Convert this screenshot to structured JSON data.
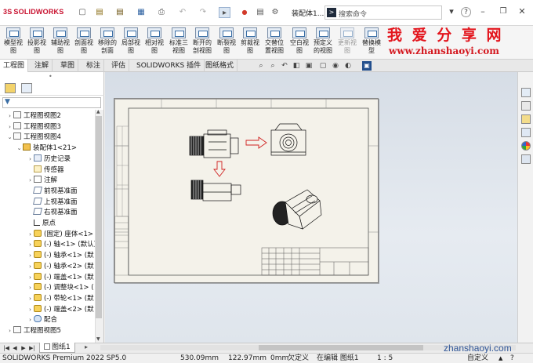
{
  "app": {
    "brand_prefix": "3S",
    "brand": "SOLIDWORKS",
    "document_title": "装配体1...",
    "search_placeholder": "搜索命令",
    "help": "?"
  },
  "quick_access": {
    "new": "▢",
    "open": "▤",
    "save": "▦",
    "print": "⎙",
    "undo": "↶",
    "redo": "↷",
    "select": "▸",
    "rebuild": "●",
    "file_props": "▤",
    "options": "⚙"
  },
  "ribbon": {
    "buttons": [
      {
        "label": "模型视\n图",
        "enabled": true
      },
      {
        "label": "投影视\n图",
        "enabled": true
      },
      {
        "label": "辅助视\n图",
        "enabled": true
      },
      {
        "label": "剖面视\n图",
        "enabled": true
      },
      {
        "label": "移除的\n剖面",
        "enabled": true
      },
      {
        "label": "局部视\n图",
        "enabled": true
      },
      {
        "label": "相对视\n图",
        "enabled": true
      },
      {
        "label": "标准三\n视图",
        "enabled": true
      },
      {
        "label": "断开的\n剖视图",
        "enabled": true
      },
      {
        "label": "断裂视\n图",
        "enabled": true
      },
      {
        "label": "剪裁视\n图",
        "enabled": true
      },
      {
        "label": "交替位\n置视图",
        "enabled": true
      },
      {
        "label": "空白视\n图",
        "enabled": true
      },
      {
        "label": "预定义\n的视图",
        "enabled": true
      },
      {
        "label": "更新视\n图",
        "enabled": false
      },
      {
        "label": "替换模\n型",
        "enabled": true
      }
    ]
  },
  "watermark": {
    "line1": "我 爱 分 享 网",
    "line2": "www.zhanshaoyi.com",
    "bottom": "zhanshaoyi.com"
  },
  "command_tabs": [
    "工程图",
    "注解",
    "草图",
    "标注",
    "评估",
    "SOLIDWORKS 插件",
    "图纸格式"
  ],
  "feature_tree": [
    {
      "label": "工程图视图2",
      "level": 1,
      "icon": "view",
      "expander": "›"
    },
    {
      "label": "工程图视图3",
      "level": 1,
      "icon": "view",
      "expander": "›"
    },
    {
      "label": "工程图视图4",
      "level": 1,
      "icon": "view",
      "expander": "⌄"
    },
    {
      "label": "装配体1<21>",
      "level": 2,
      "icon": "asm",
      "expander": "⌄"
    },
    {
      "label": "历史记录",
      "level": 3,
      "icon": "hist",
      "expander": "›"
    },
    {
      "label": "传感器",
      "level": 3,
      "icon": "sens",
      "expander": ""
    },
    {
      "label": "注解",
      "level": 3,
      "icon": "ann",
      "expander": "›"
    },
    {
      "label": "前视基准面",
      "level": 3,
      "icon": "plane",
      "expander": ""
    },
    {
      "label": "上视基准面",
      "level": 3,
      "icon": "plane",
      "expander": ""
    },
    {
      "label": "右视基准面",
      "level": 3,
      "icon": "plane",
      "expander": ""
    },
    {
      "label": "原点",
      "level": 3,
      "icon": "pt",
      "expander": ""
    },
    {
      "label": "(固定) 座体<1>",
      "level": 3,
      "icon": "yel",
      "expander": "›"
    },
    {
      "label": "(-) 轴<1> (默认)",
      "level": 3,
      "icon": "yel",
      "expander": "›"
    },
    {
      "label": "(-) 轴承<1> (默",
      "level": 3,
      "icon": "yel",
      "expander": "›"
    },
    {
      "label": "(-) 轴承<2> (默",
      "level": 3,
      "icon": "yel",
      "expander": "›"
    },
    {
      "label": "(-) 端盖<1> (默",
      "level": 3,
      "icon": "yel",
      "expander": "›"
    },
    {
      "label": "(-) 调整块<1> (",
      "level": 3,
      "icon": "yel",
      "expander": "›"
    },
    {
      "label": "(-) 带轮<1> (默",
      "level": 3,
      "icon": "yel",
      "expander": "›"
    },
    {
      "label": "(-) 端盖<2> (默",
      "level": 3,
      "icon": "yel",
      "expander": "›"
    },
    {
      "label": "配合",
      "level": 3,
      "icon": "mate",
      "expander": "›"
    },
    {
      "label": "工程图视图5",
      "level": 1,
      "icon": "view",
      "expander": "›"
    }
  ],
  "sheet_tabs": {
    "active": "图纸1",
    "add": "▸"
  },
  "status_bar": {
    "product": "SOLIDWORKS Premium 2022 SP5.0",
    "x": "530.09mm",
    "y": "122.97mm",
    "z": "0mm",
    "constraint": "欠定义",
    "editing": "在编辑 图纸1",
    "scale": "1 : 5",
    "custom": "自定义"
  }
}
